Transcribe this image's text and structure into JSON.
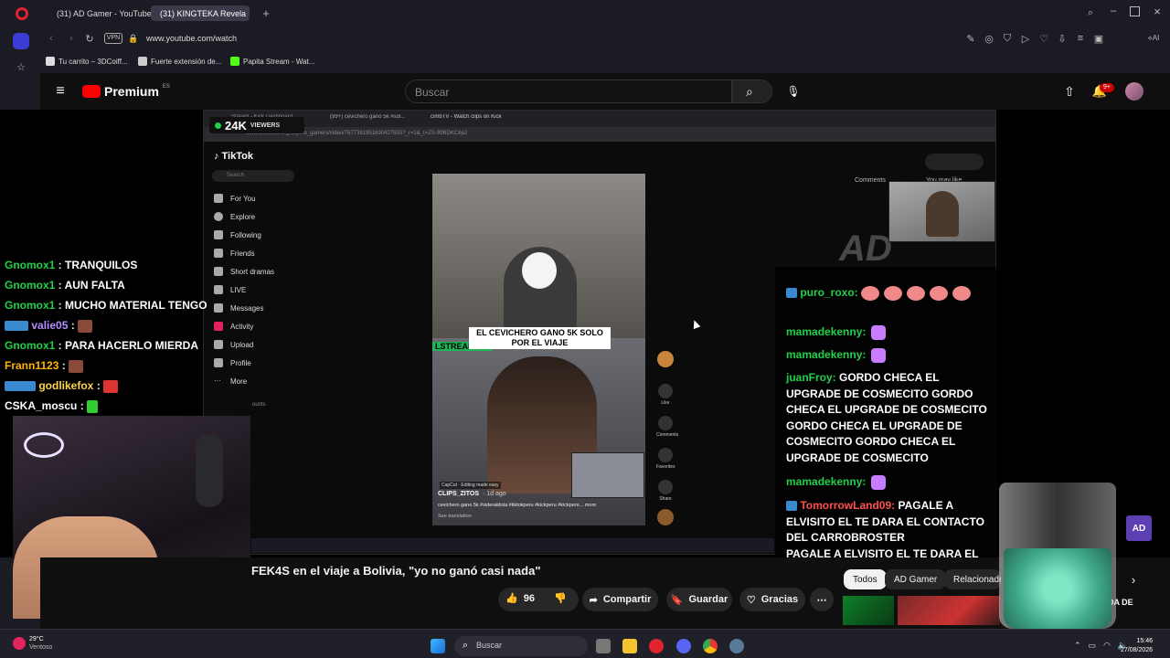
{
  "browser": {
    "tabs": [
      {
        "label": "(31) AD Gamer - YouTube",
        "active": false
      },
      {
        "label": "(31) KINGTEKA Revela",
        "active": true
      }
    ],
    "url": "www.youtube.com/watch",
    "vpn": "VPN",
    "bookmarks": [
      "Tu carrito – 3DCoiff...",
      "Fuerte extensión de...",
      "Papita Stream - Wat..."
    ]
  },
  "youtube": {
    "logo": "Premium",
    "logo_sup": "ES",
    "search_placeholder": "Buscar",
    "notif_badge": "9+"
  },
  "stream": {
    "viewers_count": "24K",
    "viewers_label": "VIEWERS",
    "inner_tabs": [
      "Stream - Kick Dashboard",
      "(99+) cevichero gano 5k #sol...",
      "cimbTV - Watch clips on Kick"
    ],
    "inner_url": "www.tiktok.com/@clipero_gamers/video/7677381951690427655?_r=1&_t=ZS-99BDKC6p2",
    "tiktok": {
      "logo": "TikTok",
      "search": "Search",
      "nav": [
        "For You",
        "Explore",
        "Following",
        "Friends",
        "Short dramas",
        "LIVE",
        "Messages",
        "Activity",
        "Upload",
        "Profile",
        "More"
      ],
      "caption": "EL CEVICHERO GANO 5K SOLO POR EL VIAJE",
      "streaming_tag": "LSTREAMING",
      "capcut": "CapCut · Editing made easy",
      "author": "CLIPS_ZITOS",
      "author_meta": "· 1d ago",
      "desc": "cevichero gano 5k #sideraldota #tiktokperu #kickperu #kickpere... more",
      "see_translation": "See translation",
      "actions": [
        "Like",
        "Comments",
        "Favorites",
        "Share"
      ],
      "comments_tab": "Comments",
      "you_may_like": "You may like",
      "accounts_label": "ounts"
    },
    "left_chat": [
      {
        "user": "Gnomox1",
        "msg": "TRANQUILOS",
        "color": "#21d04a"
      },
      {
        "user": "Gnomox1",
        "msg": "AUN FALTA",
        "color": "#21d04a"
      },
      {
        "user": "Gnomox1",
        "msg": "MUCHO MATERIAL TENGO",
        "color": "#21d04a"
      },
      {
        "user": "valie05",
        "msg": "",
        "color": "#b48cff"
      },
      {
        "user": "Gnomox1",
        "msg": "PARA HACERLO MIERDA",
        "color": "#21d04a"
      },
      {
        "user": "Frann1123",
        "msg": "",
        "color": "#ffb300"
      },
      {
        "user": "godlikefox",
        "msg": "",
        "color": "#ffd54a"
      },
      {
        "user": "CSKA_moscu",
        "msg": "",
        "color": "#ffffff"
      }
    ],
    "right_chat": [
      {
        "user": "puro_roxo:",
        "msg": "",
        "color": "#21d04a"
      },
      {
        "user": "mamadekenny:",
        "msg": "",
        "color": "#21d04a"
      },
      {
        "user": "mamadekenny:",
        "msg": "",
        "color": "#21d04a"
      },
      {
        "user": "juanFroy:",
        "msg": "GORDO CHECA EL UPGRADE DE COSMECITO GORDO CHECA EL UPGRADE DE COSMECITO GORDO CHECA EL UPGRADE DE COSMECITO GORDO CHECA EL UPGRADE DE COSMECITO",
        "color": "#21d04a"
      },
      {
        "user": "mamadekenny:",
        "msg": "",
        "color": "#21d04a"
      },
      {
        "user": "TomorrowLand09:",
        "msg": "PAGALE A ELVISITO EL TE DARA EL CONTACTO DEL CARROBROSTER",
        "color": "#ff4f4f"
      },
      {
        "user": "",
        "msg": "PAGALE A ELVISITO EL TE DARA EL",
        "color": "#ff4f4f"
      }
    ]
  },
  "video_meta": {
    "title": "FEK4S en el viaje a Bolivia, \"yo no ganó casi nada\"",
    "likes": "96",
    "share": "Compartir",
    "save": "Guardar",
    "thanks": "Gracias",
    "chips": [
      "Todos",
      "AD Gamer",
      "Relacionado"
    ],
    "side_text": "DA DE"
  },
  "taskbar": {
    "temp": "29°C",
    "weather": "Ventoso",
    "search": "Buscar",
    "time": "15:46",
    "date": "27/08/2026"
  }
}
